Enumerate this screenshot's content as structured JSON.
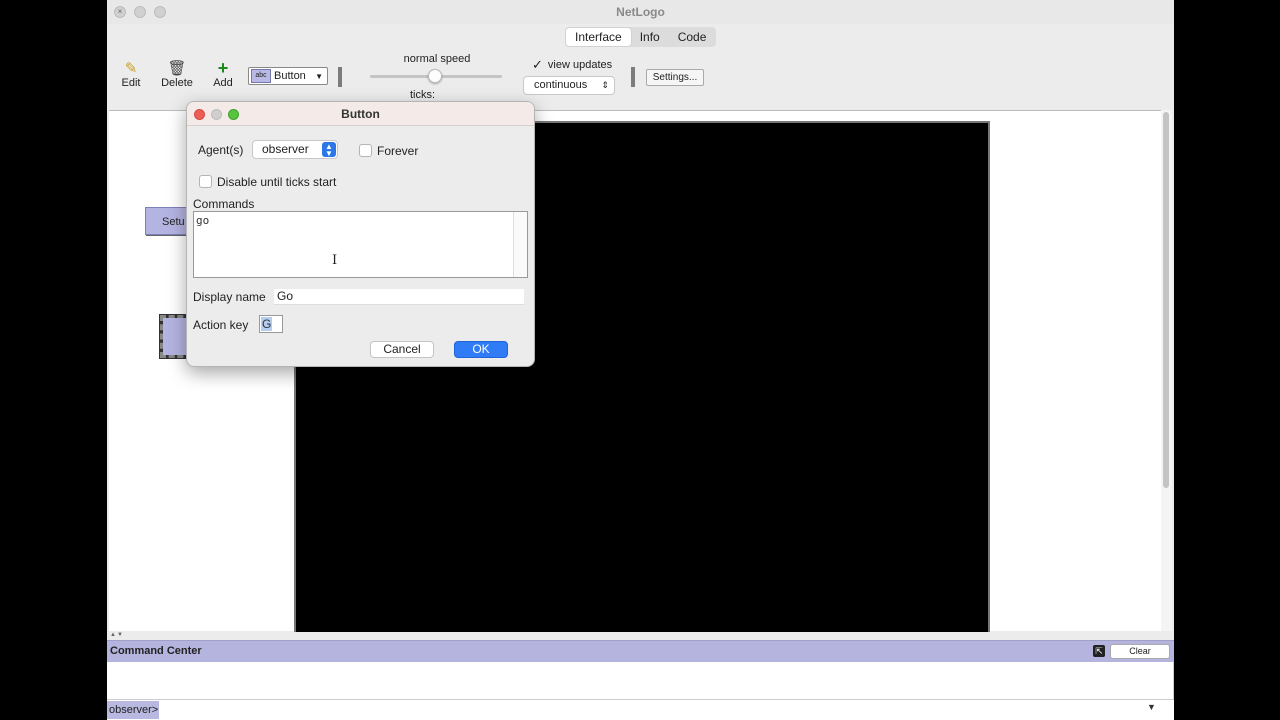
{
  "window": {
    "title": "NetLogo"
  },
  "tabs": [
    "Interface",
    "Info",
    "Code"
  ],
  "toolbar": {
    "edit_label": "Edit",
    "delete_label": "Delete",
    "add_label": "Add",
    "widget_type": "Button",
    "speed_label": "normal speed",
    "ticks_label": "ticks:",
    "view_updates_label": "view updates",
    "update_mode": "continuous",
    "settings_label": "Settings..."
  },
  "widgets": {
    "setup_label": "Setu"
  },
  "command_center": {
    "title": "Command Center",
    "clear_label": "Clear",
    "prompt": "observer>"
  },
  "dialog": {
    "title": "Button",
    "agents_label": "Agent(s)",
    "agents_value": "observer",
    "forever_label": "Forever",
    "disable_label": "Disable until ticks start",
    "commands_label": "Commands",
    "commands_value": "go",
    "display_name_label": "Display name",
    "display_name_value": "Go",
    "action_key_label": "Action key",
    "action_key_value": "G",
    "cancel_label": "Cancel",
    "ok_label": "OK"
  },
  "colors": {
    "button_widget": "#b4b4e2",
    "command_center_header": "#b4b4de",
    "ok_button": "#2f7cf6"
  }
}
